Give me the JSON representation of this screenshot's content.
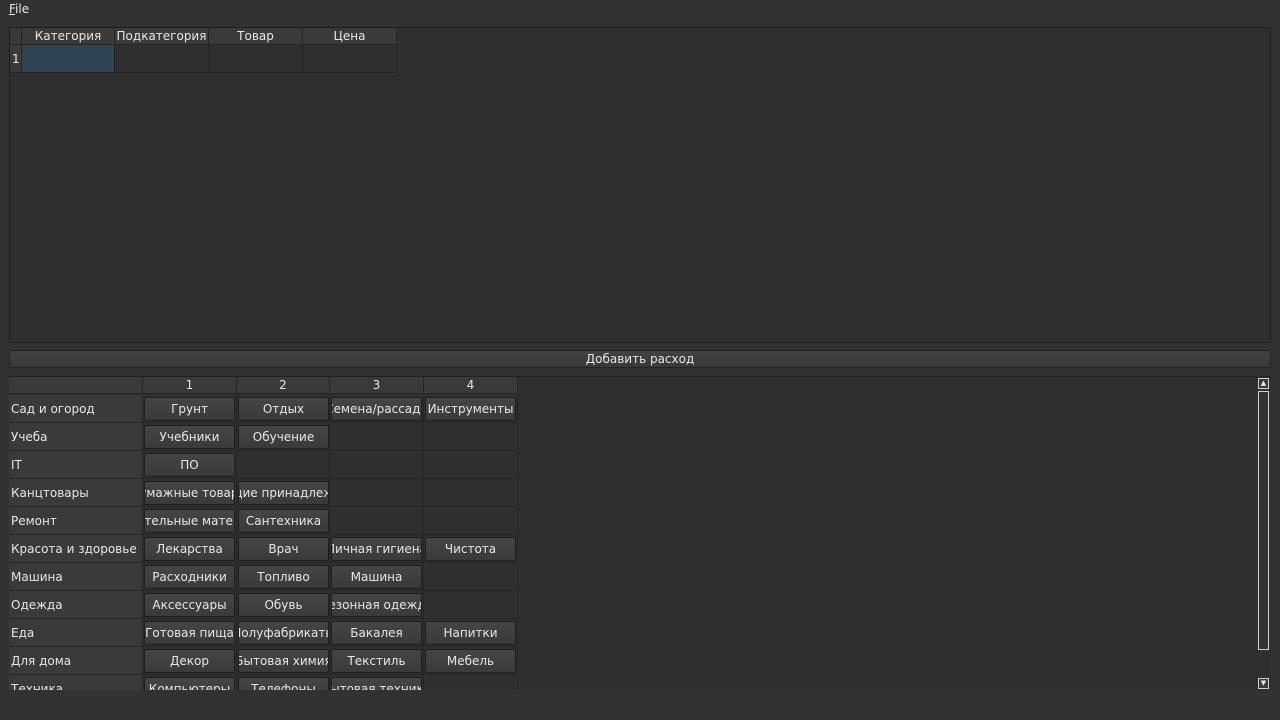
{
  "menu": {
    "file_first": "F",
    "file_rest": "ile"
  },
  "top_table": {
    "columns": [
      "Категория",
      "Подкатегория",
      "Товар",
      "Цена"
    ],
    "row_label": "1"
  },
  "add_button": "Добавить расход",
  "grid": {
    "columns": [
      "1",
      "2",
      "3",
      "4"
    ],
    "rows": [
      {
        "label": "Сад и огород",
        "items": [
          "Грунт",
          "Отдых",
          "Семена/рассада",
          "Инструменты"
        ]
      },
      {
        "label": "Учеба",
        "items": [
          "Учебники",
          "Обучение"
        ]
      },
      {
        "label": "IT",
        "items": [
          "ПО"
        ]
      },
      {
        "label": "Канцтовары",
        "items": [
          "Бумажные товары",
          "Пишущие принадлежности"
        ]
      },
      {
        "label": "Ремонт",
        "items": [
          "Строительные материалы",
          "Сантехника"
        ]
      },
      {
        "label": "Красота и здоровье",
        "items": [
          "Лекарства",
          "Врач",
          "Личная гигиена",
          "Чистота"
        ]
      },
      {
        "label": "Машина",
        "items": [
          "Расходники",
          "Топливо",
          "Машина"
        ]
      },
      {
        "label": "Одежда",
        "items": [
          "Аксессуары",
          "Обувь",
          "Сезонная одежда"
        ]
      },
      {
        "label": "Еда",
        "items": [
          "Готовая пища",
          "Полуфабрикаты",
          "Бакалея",
          "Напитки"
        ]
      },
      {
        "label": "Для дома",
        "items": [
          "Декор",
          "Бытовая химия",
          "Текстиль",
          "Мебель"
        ]
      },
      {
        "label": "Техника",
        "items": [
          "Компьютеры",
          "Телефоны",
          "Бытовая техника"
        ]
      }
    ]
  },
  "icons": {
    "scroll_up": "arrow-up-icon",
    "scroll_down": "arrow-down-icon"
  }
}
